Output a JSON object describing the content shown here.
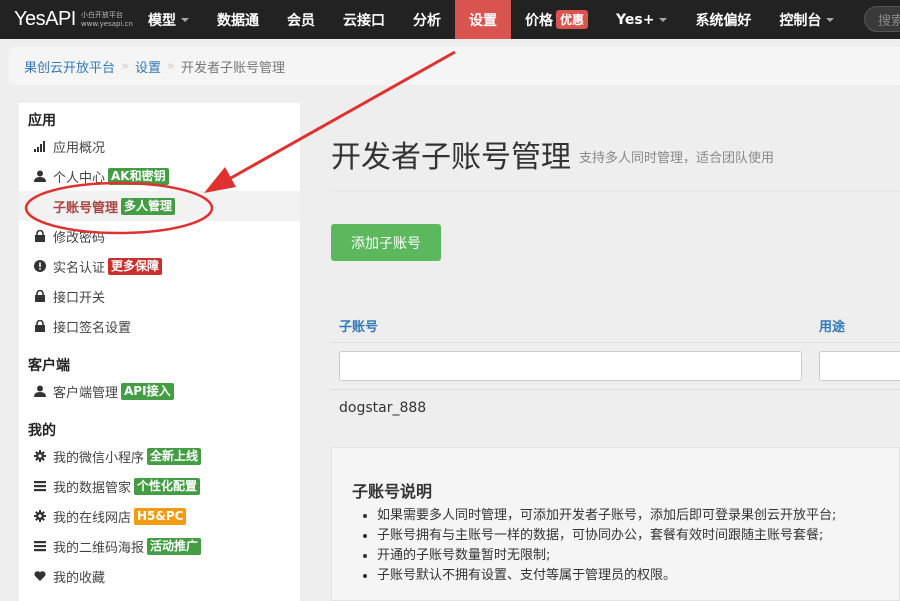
{
  "navbar": {
    "logo": "YesAPI",
    "logo_sub1": "小白开放平台",
    "logo_sub2": "www.yesapi.cn",
    "items": [
      {
        "label": "模型",
        "caret": true
      },
      {
        "label": "数据通"
      },
      {
        "label": "会员"
      },
      {
        "label": "云接口"
      },
      {
        "label": "分析"
      },
      {
        "label": "设置",
        "active": true
      },
      {
        "label": "价格",
        "badge": "优惠"
      },
      {
        "label": "Yes+",
        "caret": true
      },
      {
        "label": "系统偏好"
      },
      {
        "label": "控制台",
        "caret": true
      }
    ],
    "search_placeholder": "搜索"
  },
  "breadcrumb": {
    "items": [
      "果创云开放平台",
      "设置"
    ],
    "current": "开发者子账号管理",
    "separator": "»"
  },
  "sidebar": {
    "sections": [
      {
        "title": "应用",
        "items": [
          {
            "label": "应用概况",
            "icon": "signal-icon"
          },
          {
            "label": "个人中心",
            "icon": "user-icon",
            "badge": "AK和密钥",
            "badge_color": "green"
          },
          {
            "label": "子账号管理",
            "icon": "",
            "badge": "多人管理",
            "badge_color": "green",
            "active": true
          },
          {
            "label": "修改密码",
            "icon": "lock-icon"
          },
          {
            "label": "实名认证",
            "icon": "exclamation-icon",
            "badge": "更多保障",
            "badge_color": "red"
          },
          {
            "label": "接口开关",
            "icon": "lock-icon"
          },
          {
            "label": "接口签名设置",
            "icon": "lock-icon"
          }
        ]
      },
      {
        "title": "客户端",
        "items": [
          {
            "label": "客户端管理",
            "icon": "user-icon",
            "badge": "API接入",
            "badge_color": "green"
          }
        ]
      },
      {
        "title": "我的",
        "items": [
          {
            "label": "我的微信小程序",
            "icon": "gear-icon",
            "badge": "全新上线",
            "badge_color": "green"
          },
          {
            "label": "我的数据管家",
            "icon": "list-icon",
            "badge": "个性化配置",
            "badge_color": "green"
          },
          {
            "label": "我的在线网店",
            "icon": "gear-icon",
            "badge": "H5&PC",
            "badge_color": "orange"
          },
          {
            "label": "我的二维码海报",
            "icon": "list-icon",
            "badge": "活动推广",
            "badge_color": "green"
          },
          {
            "label": "我的收藏",
            "icon": "heart-icon"
          }
        ]
      }
    ]
  },
  "main": {
    "title": "开发者子账号管理",
    "subtitle": "支持多人同时管理，适合团队使用",
    "add_button": "添加子账号",
    "table": {
      "columns": [
        "子账号",
        "用途"
      ],
      "rows": [
        [
          "dogstar_888",
          ""
        ]
      ]
    },
    "info": {
      "title": "子账号说明",
      "items": [
        "如果需要多人同时管理，可添加开发者子账号，添加后即可登录果创云开放平台;",
        "子账号拥有与主账号一样的数据，可协同办公，套餐有效时间跟随主账号套餐;",
        "开通的子账号数量暂时无限制;",
        "子账号默认不拥有设置、支付等属于管理员的权限。"
      ]
    }
  },
  "colors": {
    "navbar_bg": "#222222",
    "active_nav": "#d9534f",
    "link": "#337ab7",
    "green": "#5cb85c",
    "annotation_red": "#e03131"
  }
}
